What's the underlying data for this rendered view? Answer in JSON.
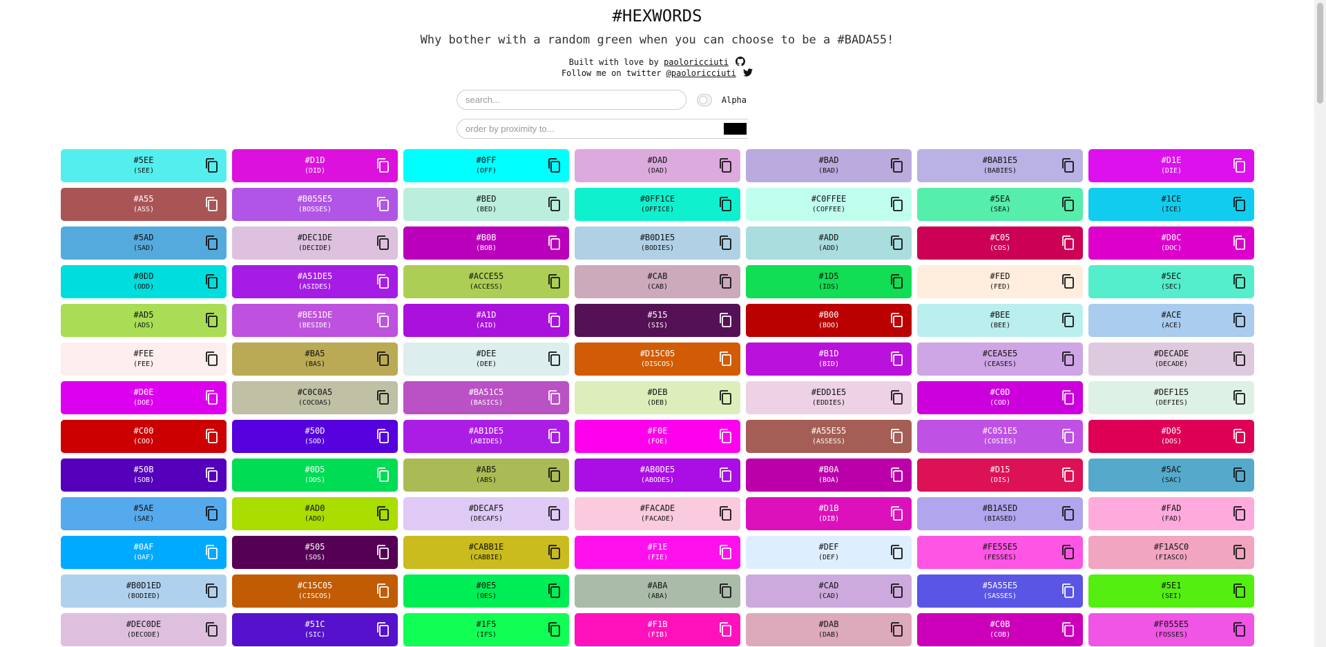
{
  "header": {
    "title": "#HEXWORDS",
    "subtitle": "Why bother with a random green when you can choose to be a #BADA55!",
    "built_prefix": "Built with love by",
    "built_link": "paoloricciuti",
    "follow_prefix": "Follow me on twitter",
    "follow_link": "@paoloricciuti"
  },
  "search": {
    "placeholder": "search..."
  },
  "alpha": {
    "label": "Alpha",
    "enabled": false
  },
  "proximity": {
    "placeholder": "order by proximity to...",
    "color": "#000000"
  },
  "icons": {
    "copy": "copy-icon",
    "github": "github-icon",
    "twitter": "twitter-icon"
  },
  "colors": [
    {
      "hex": "#5EE",
      "word": "(SEE)"
    },
    {
      "hex": "#D1D",
      "word": "(DID)"
    },
    {
      "hex": "#0FF",
      "word": "(OFF)"
    },
    {
      "hex": "#DAD",
      "word": "(DAD)"
    },
    {
      "hex": "#BAD",
      "word": "(BAD)"
    },
    {
      "hex": "#BAB1E5",
      "word": "(BABIES)"
    },
    {
      "hex": "#D1E",
      "word": "(DIE)"
    },
    {
      "hex": "#A55",
      "word": "(ASS)"
    },
    {
      "hex": "#B055E5",
      "word": "(BOSSES)"
    },
    {
      "hex": "#BED",
      "word": "(BED)"
    },
    {
      "hex": "#0FF1CE",
      "word": "(OFFICE)"
    },
    {
      "hex": "#C0FFEE",
      "word": "(COFFEE)"
    },
    {
      "hex": "#5EA",
      "word": "(SEA)"
    },
    {
      "hex": "#1CE",
      "word": "(ICE)"
    },
    {
      "hex": "#5AD",
      "word": "(SAD)"
    },
    {
      "hex": "#DEC1DE",
      "word": "(DECIDE)"
    },
    {
      "hex": "#B0B",
      "word": "(BOB)"
    },
    {
      "hex": "#B0D1E5",
      "word": "(BODIES)"
    },
    {
      "hex": "#ADD",
      "word": "(ADD)"
    },
    {
      "hex": "#C05",
      "word": "(COS)"
    },
    {
      "hex": "#D0C",
      "word": "(DOC)"
    },
    {
      "hex": "#0DD",
      "word": "(ODD)"
    },
    {
      "hex": "#A51DE5",
      "word": "(ASIDES)"
    },
    {
      "hex": "#ACCE55",
      "word": "(ACCESS)"
    },
    {
      "hex": "#CAB",
      "word": "(CAB)"
    },
    {
      "hex": "#1D5",
      "word": "(IDS)"
    },
    {
      "hex": "#FED",
      "word": "(FED)"
    },
    {
      "hex": "#5EC",
      "word": "(SEC)"
    },
    {
      "hex": "#AD5",
      "word": "(ADS)"
    },
    {
      "hex": "#BE51DE",
      "word": "(BESIDE)"
    },
    {
      "hex": "#A1D",
      "word": "(AID)"
    },
    {
      "hex": "#515",
      "word": "(SIS)"
    },
    {
      "hex": "#B00",
      "word": "(BOO)"
    },
    {
      "hex": "#BEE",
      "word": "(BEE)"
    },
    {
      "hex": "#ACE",
      "word": "(ACE)"
    },
    {
      "hex": "#FEE",
      "word": "(FEE)"
    },
    {
      "hex": "#BA5",
      "word": "(BAS)"
    },
    {
      "hex": "#DEE",
      "word": "(DEE)"
    },
    {
      "hex": "#D15C05",
      "word": "(DISCOS)"
    },
    {
      "hex": "#B1D",
      "word": "(BID)"
    },
    {
      "hex": "#CEA5E5",
      "word": "(CEASES)"
    },
    {
      "hex": "#DECADE",
      "word": "(DECADE)"
    },
    {
      "hex": "#D0E",
      "word": "(DOE)"
    },
    {
      "hex": "#C0C0A5",
      "word": "(COCOAS)"
    },
    {
      "hex": "#BA51C5",
      "word": "(BASICS)"
    },
    {
      "hex": "#DEB",
      "word": "(DEB)"
    },
    {
      "hex": "#EDD1E5",
      "word": "(EDDIES)"
    },
    {
      "hex": "#C0D",
      "word": "(COD)"
    },
    {
      "hex": "#DEF1E5",
      "word": "(DEFIES)"
    },
    {
      "hex": "#C00",
      "word": "(COO)"
    },
    {
      "hex": "#50D",
      "word": "(SOD)"
    },
    {
      "hex": "#AB1DE5",
      "word": "(ABIDES)"
    },
    {
      "hex": "#F0E",
      "word": "(FOE)"
    },
    {
      "hex": "#A55E55",
      "word": "(ASSESS)"
    },
    {
      "hex": "#C051E5",
      "word": "(COSIES)"
    },
    {
      "hex": "#D05",
      "word": "(DOS)"
    },
    {
      "hex": "#50B",
      "word": "(SOB)"
    },
    {
      "hex": "#0D5",
      "word": "(ODS)"
    },
    {
      "hex": "#AB5",
      "word": "(ABS)"
    },
    {
      "hex": "#AB0DE5",
      "word": "(ABODES)"
    },
    {
      "hex": "#B0A",
      "word": "(BOA)"
    },
    {
      "hex": "#D15",
      "word": "(DIS)"
    },
    {
      "hex": "#5AC",
      "word": "(SAC)"
    },
    {
      "hex": "#5AE",
      "word": "(SAE)"
    },
    {
      "hex": "#AD0",
      "word": "(ADO)"
    },
    {
      "hex": "#DECAF5",
      "word": "(DECAFS)"
    },
    {
      "hex": "#FACADE",
      "word": "(FACADE)"
    },
    {
      "hex": "#D1B",
      "word": "(DIB)"
    },
    {
      "hex": "#B1A5ED",
      "word": "(BIASED)"
    },
    {
      "hex": "#FAD",
      "word": "(FAD)"
    },
    {
      "hex": "#0AF",
      "word": "(OAF)"
    },
    {
      "hex": "#505",
      "word": "(SOS)"
    },
    {
      "hex": "#CABB1E",
      "word": "(CABBIE)"
    },
    {
      "hex": "#F1E",
      "word": "(FIE)"
    },
    {
      "hex": "#DEF",
      "word": "(DEF)"
    },
    {
      "hex": "#FE55E5",
      "word": "(FESSES)"
    },
    {
      "hex": "#F1A5C0",
      "word": "(FIASCO)"
    },
    {
      "hex": "#B0D1ED",
      "word": "(BODIED)"
    },
    {
      "hex": "#C15C05",
      "word": "(CISCOS)"
    },
    {
      "hex": "#0E5",
      "word": "(OES)"
    },
    {
      "hex": "#ABA",
      "word": "(ABA)"
    },
    {
      "hex": "#CAD",
      "word": "(CAD)"
    },
    {
      "hex": "#5A55E5",
      "word": "(SASSES)"
    },
    {
      "hex": "#5E1",
      "word": "(SEI)"
    },
    {
      "hex": "#DEC0DE",
      "word": "(DECODE)"
    },
    {
      "hex": "#51C",
      "word": "(SIC)"
    },
    {
      "hex": "#1F5",
      "word": "(IFS)"
    },
    {
      "hex": "#F1B",
      "word": "(FIB)"
    },
    {
      "hex": "#DAB",
      "word": "(DAB)"
    },
    {
      "hex": "#C0B",
      "word": "(COB)"
    },
    {
      "hex": "#F055E5",
      "word": "(FOSSES)"
    }
  ]
}
